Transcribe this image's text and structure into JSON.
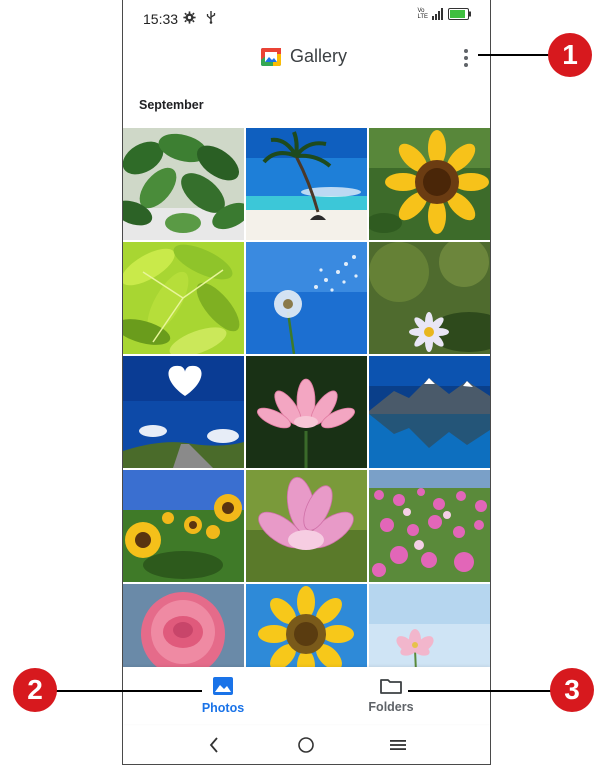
{
  "status_bar": {
    "time": "15:33",
    "icons": [
      "gear-icon",
      "usb-icon"
    ],
    "network_top": "Vo",
    "network_bottom": "LTE",
    "signal": "4G"
  },
  "app_bar": {
    "title": "Gallery",
    "menu_icon": "more-vert-icon"
  },
  "section": {
    "label": "September"
  },
  "photos": [
    {
      "subject": "green-plant-leaves"
    },
    {
      "subject": "palm-tree-beach"
    },
    {
      "subject": "sunflower"
    },
    {
      "subject": "green-leaves-closeup"
    },
    {
      "subject": "dandelion-blue-sky"
    },
    {
      "subject": "daisy-flower"
    },
    {
      "subject": "heart-cloud-road"
    },
    {
      "subject": "pink-lotus"
    },
    {
      "subject": "mountain-lake"
    },
    {
      "subject": "sunflower-field"
    },
    {
      "subject": "pink-magnolia"
    },
    {
      "subject": "cosmos-flower-field"
    },
    {
      "subject": "pink-rose"
    },
    {
      "subject": "sunflower-closeup"
    },
    {
      "subject": "pink-flower-sky"
    }
  ],
  "bottom_nav": {
    "photos_label": "Photos",
    "folders_label": "Folders",
    "active": "photos"
  },
  "system_nav": {
    "back": "back-icon",
    "home": "home-icon",
    "recents": "recents-icon"
  },
  "callouts": {
    "one": "1",
    "two": "2",
    "three": "3"
  },
  "colors": {
    "accent": "#1a73e8",
    "callout": "#d7191e"
  }
}
